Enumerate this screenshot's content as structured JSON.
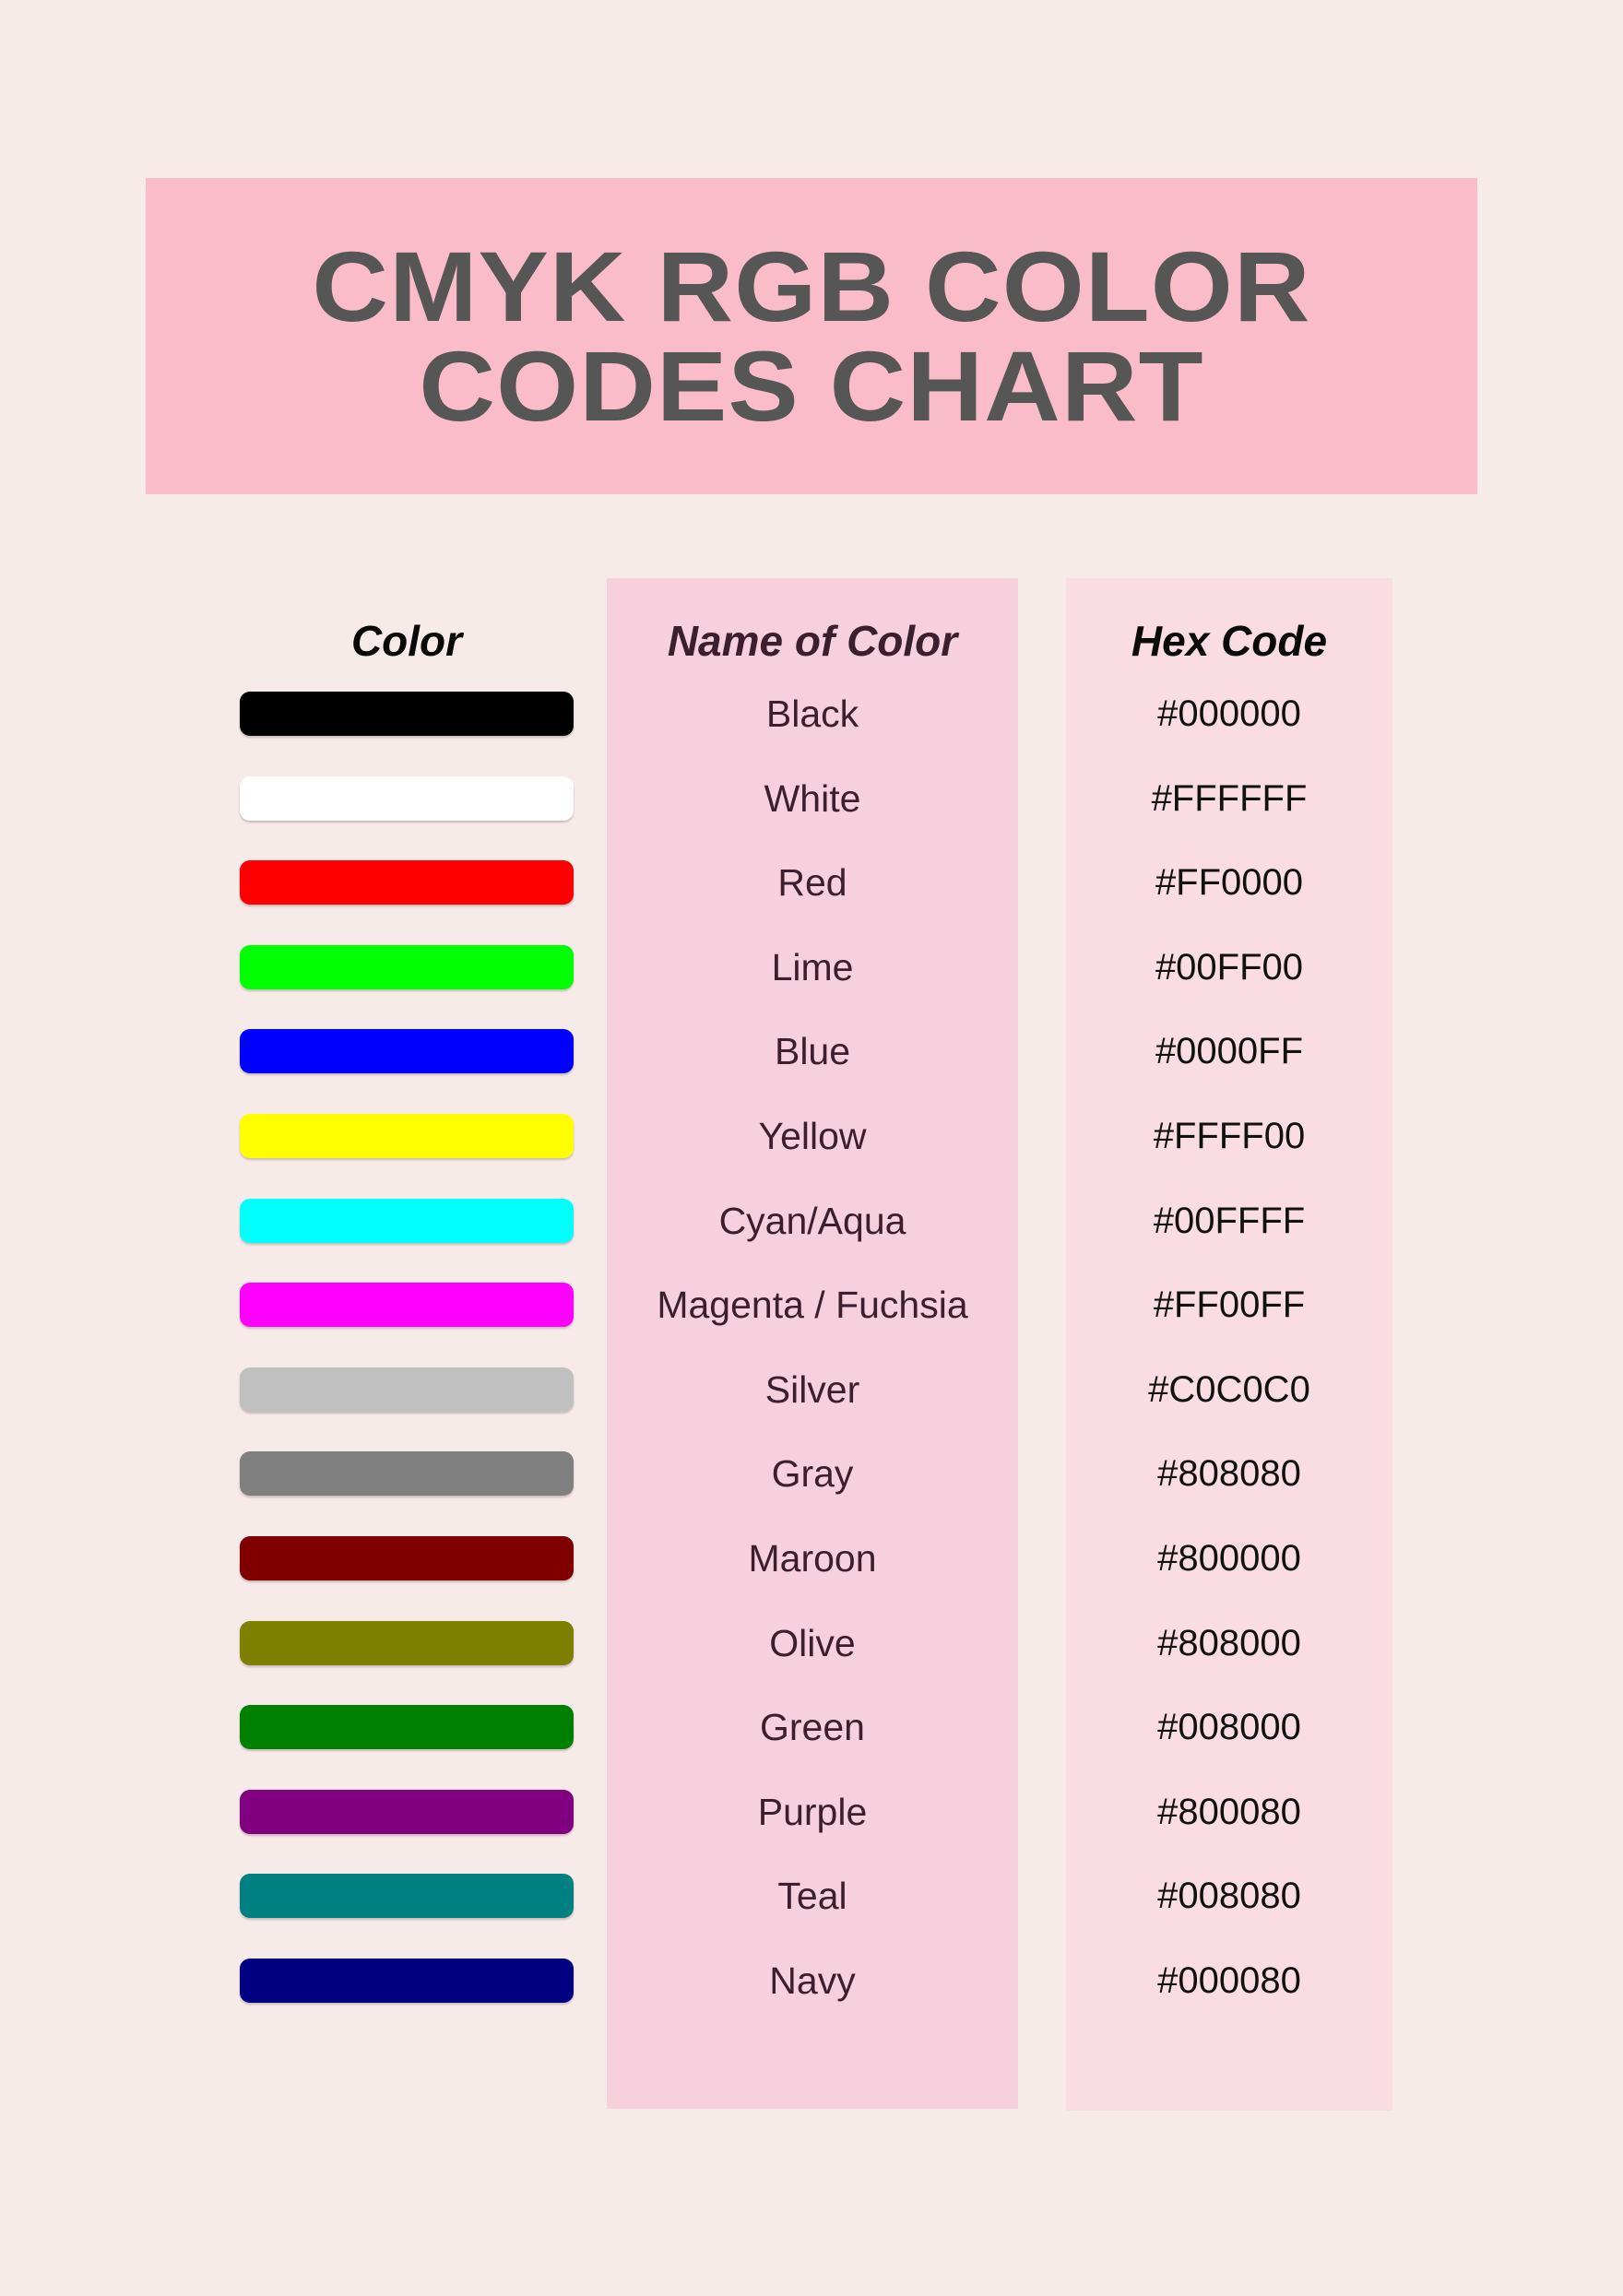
{
  "page": {
    "background_color": "#f7ebe9"
  },
  "title": {
    "text": "CMYK RGB Color Codes Chart",
    "banner_color": "#fbbcca",
    "text_color": "#565656"
  },
  "headers": {
    "color": "Color",
    "name": "Name of Color",
    "hex": "Hex Code"
  },
  "panels": {
    "name_panel_color": "#f6d0dd",
    "hex_panel_color": "#fadde2"
  },
  "chart_data": {
    "type": "table",
    "title": "CMYK RGB Color Codes Chart",
    "columns": [
      "Color",
      "Name of Color",
      "Hex Code"
    ],
    "rows": [
      {
        "name": "Black",
        "hex": "#000000",
        "swatch": "#000000"
      },
      {
        "name": "White",
        "hex": "#FFFFFF",
        "swatch": "#FFFFFF"
      },
      {
        "name": "Red",
        "hex": "#FF0000",
        "swatch": "#FF0000"
      },
      {
        "name": "Lime",
        "hex": "#00FF00",
        "swatch": "#00FF00"
      },
      {
        "name": "Blue",
        "hex": "#0000FF",
        "swatch": "#0000FF"
      },
      {
        "name": "Yellow",
        "hex": "#FFFF00",
        "swatch": "#FFFF00"
      },
      {
        "name": "Cyan/Aqua",
        "hex": "#00FFFF",
        "swatch": "#00FFFF"
      },
      {
        "name": "Magenta / Fuchsia",
        "hex": "#FF00FF",
        "swatch": "#FF00FF"
      },
      {
        "name": "Silver",
        "hex": "#C0C0C0",
        "swatch": "#C0C0C0"
      },
      {
        "name": "Gray",
        "hex": "#808080",
        "swatch": "#808080"
      },
      {
        "name": "Maroon",
        "hex": "#800000",
        "swatch": "#800000"
      },
      {
        "name": "Olive",
        "hex": "#808000",
        "swatch": "#808000"
      },
      {
        "name": "Green",
        "hex": "#008000",
        "swatch": "#008000"
      },
      {
        "name": "Purple",
        "hex": "#800080",
        "swatch": "#800080"
      },
      {
        "name": "Teal",
        "hex": "#008080",
        "swatch": "#008080"
      },
      {
        "name": "Navy",
        "hex": "#000080",
        "swatch": "#000080"
      }
    ]
  }
}
